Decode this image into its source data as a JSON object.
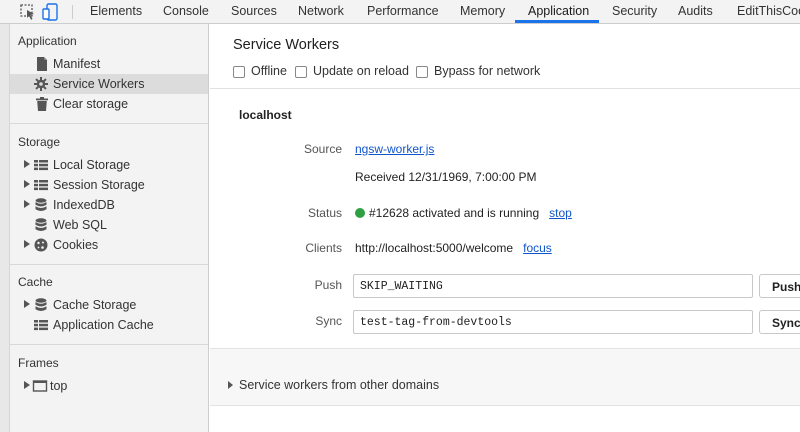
{
  "tabs": [
    "Elements",
    "Console",
    "Sources",
    "Network",
    "Performance",
    "Memory",
    "Application",
    "Security",
    "Audits",
    "EditThisCoo"
  ],
  "active_tab": "Application",
  "sidebar": {
    "application": {
      "title": "Application",
      "items": [
        "Manifest",
        "Service Workers",
        "Clear storage"
      ]
    },
    "storage": {
      "title": "Storage",
      "items": [
        "Local Storage",
        "Session Storage",
        "IndexedDB",
        "Web SQL",
        "Cookies"
      ]
    },
    "cache": {
      "title": "Cache",
      "items": [
        "Cache Storage",
        "Application Cache"
      ]
    },
    "frames": {
      "title": "Frames",
      "items": [
        "top"
      ]
    }
  },
  "main": {
    "title": "Service Workers",
    "options": [
      "Offline",
      "Update on reload",
      "Bypass for network"
    ],
    "host": "localhost",
    "source_label": "Source",
    "source_link": "ngsw-worker.js",
    "received": "Received 12/31/1969, 7:00:00 PM",
    "status_label": "Status",
    "status_text": "#12628 activated and is running",
    "status_action": "stop",
    "clients_label": "Clients",
    "clients_url": "http://localhost:5000/welcome",
    "clients_action": "focus",
    "push_label": "Push",
    "push_value": "SKIP_WAITING",
    "push_button": "Push",
    "sync_label": "Sync",
    "sync_value": "test-tag-from-devtools",
    "sync_button": "Sync",
    "other_domains": "Service workers from other domains"
  },
  "colors": {
    "accent": "#1a73e8",
    "link": "#1155cc",
    "status_dot": "#2ea043"
  }
}
